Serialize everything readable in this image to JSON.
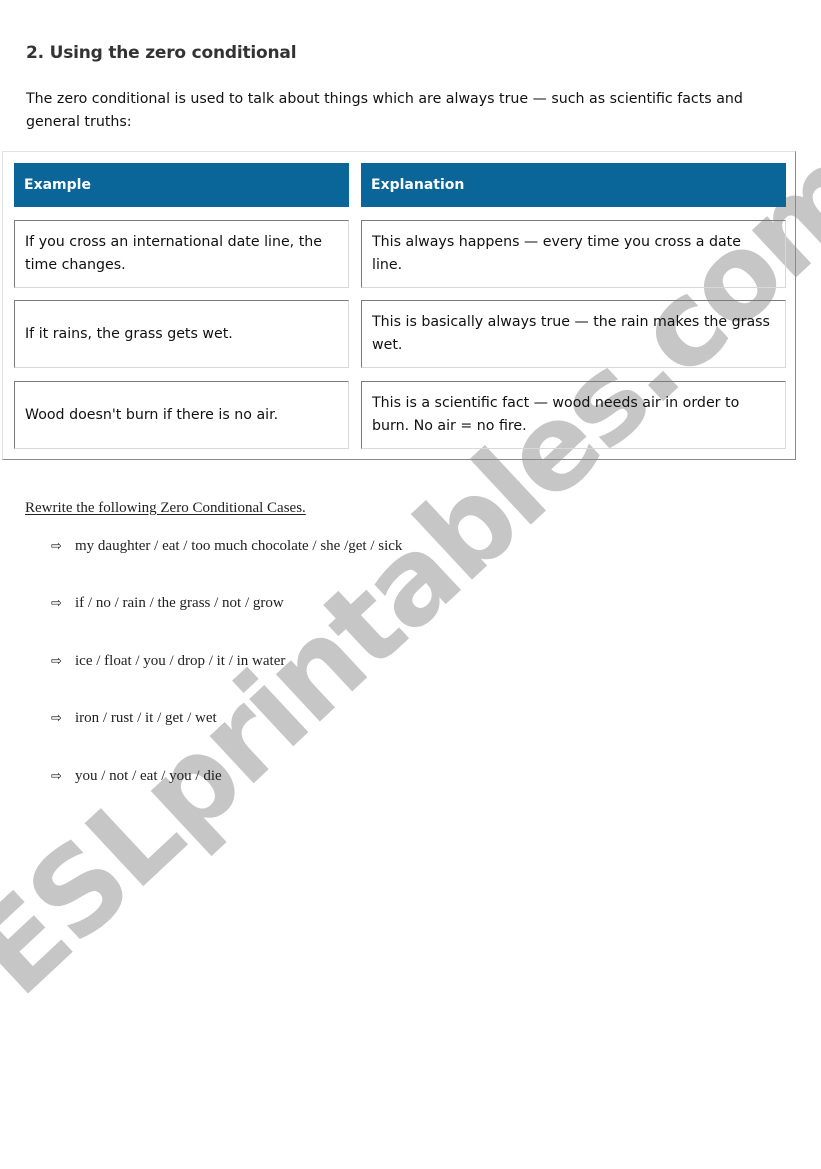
{
  "watermark": {
    "text": "ESLprintables.com",
    "color": "#c6c6c6"
  },
  "section": {
    "title": "2. Using the zero conditional",
    "intro": "The zero conditional is used to talk about things which are always true — such as scientific facts and general truths:"
  },
  "table": {
    "header_color": "#0a6699",
    "headers": [
      "Example",
      "Explanation"
    ],
    "rows": [
      {
        "example": "If you cross an international date line, the time changes.",
        "explanation": "This always happens — every time you cross a date line."
      },
      {
        "example": "If it rains, the grass gets wet.",
        "explanation": "This is basically always true — the rain makes the grass wet."
      },
      {
        "example": "Wood doesn't burn if there is no air.",
        "explanation": "This is a scientific fact — wood needs air in order to burn. No air = no fire."
      }
    ]
  },
  "exercise": {
    "title": "Rewrite the following Zero Conditional Cases.",
    "bullet_icon": "⇨",
    "items": [
      "my daughter / eat / too much chocolate / she /get / sick",
      "if / no / rain / the grass / not / grow",
      "ice / float / you / drop / it / in water",
      "iron / rust / it / get / wet",
      "you / not / eat / you / die"
    ]
  }
}
